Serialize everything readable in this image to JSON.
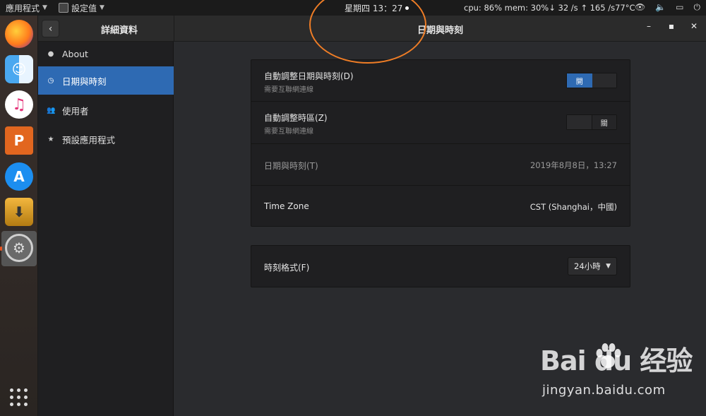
{
  "topbar": {
    "apps_menu": "應用程式",
    "settings_menu": "設定值",
    "clock": "星期四 13：27",
    "sysmon": "cpu: 86% mem: 30%↓  32  /s ↑  165  /s77°C",
    "tray_icons": [
      "visibility-icon",
      "volume-icon",
      "battery-icon",
      "power-icon"
    ]
  },
  "dock": {
    "apps": [
      "firefox",
      "finder",
      "itunes",
      "wps-presentation",
      "app-store",
      "drive-installer",
      "system-settings"
    ],
    "show_apps": "show-apps-grid"
  },
  "header": {
    "back_label": "‹",
    "left_title": "詳細資料",
    "title": "日期與時刻",
    "controls": [
      "–",
      "▪",
      "✕"
    ]
  },
  "sidebar": {
    "items": [
      {
        "label": "About",
        "icon": "info-icon"
      },
      {
        "label": "日期與時刻",
        "icon": "clock-icon",
        "active": true
      },
      {
        "label": "使用者",
        "icon": "users-icon"
      },
      {
        "label": "預設應用程式",
        "icon": "star-icon"
      }
    ]
  },
  "settings": {
    "auto_datetime": {
      "title": "自動調整日期與時刻(D)",
      "subtitle": "需要互聯網連線",
      "switch_label": "開",
      "on": true
    },
    "auto_timezone": {
      "title": "自動調整時區(Z)",
      "subtitle": "需要互聯網連線",
      "switch_label": "關",
      "on": false
    },
    "datetime": {
      "title": "日期與時刻(T)",
      "value": "2019年8月8日，13:27"
    },
    "timezone": {
      "title": "Time Zone",
      "value": "CST (Shanghai，中國)"
    },
    "time_format": {
      "title": "時刻格式(F)",
      "selected": "24小時"
    }
  },
  "watermark": {
    "logo": "Bai  du 经验",
    "url": "jingyan.baidu.com"
  },
  "colors": {
    "accent": "#2e6ab3",
    "annotation": "#ef7d26",
    "background": "#2a2b2e",
    "panel": "#1f1f21"
  }
}
